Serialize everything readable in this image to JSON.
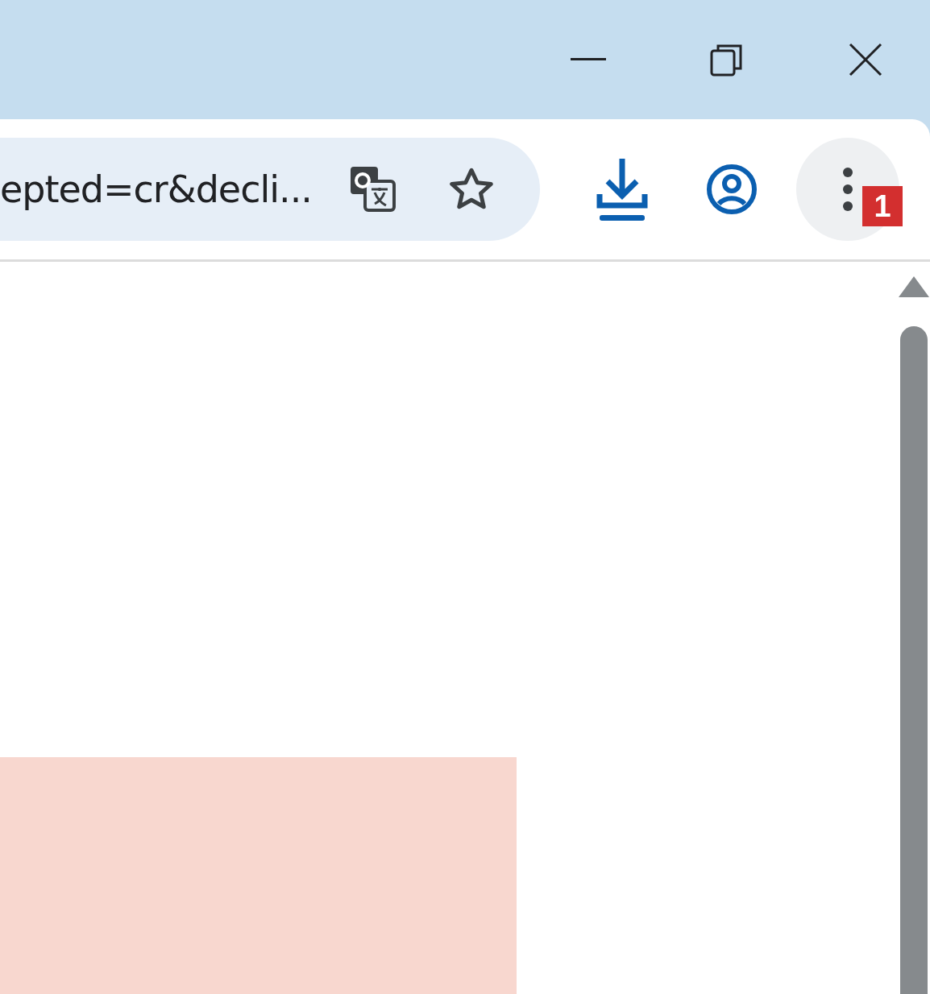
{
  "address_bar": {
    "url": "epted=cr&decli..."
  },
  "menu_button": {
    "badge": "1"
  }
}
